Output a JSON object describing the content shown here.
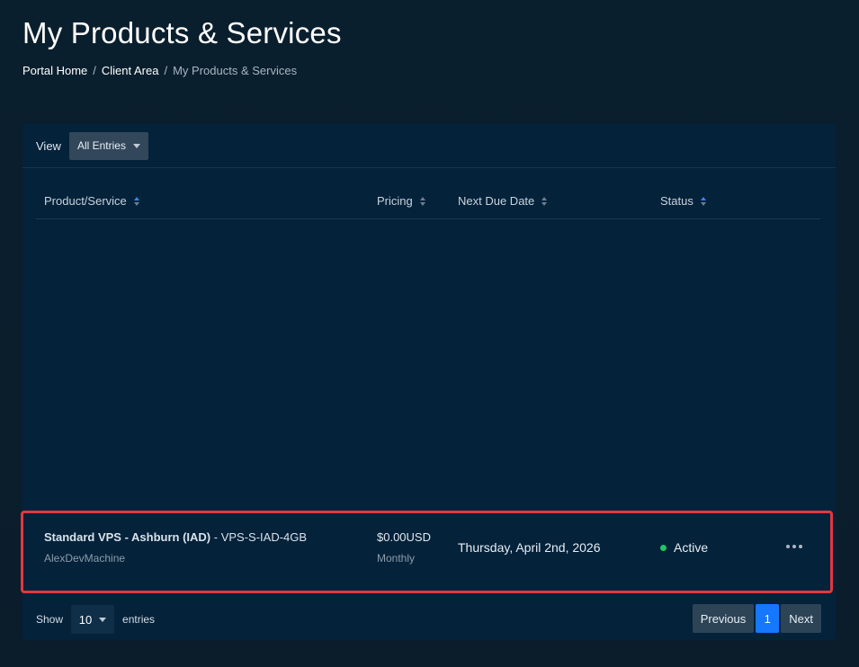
{
  "page": {
    "title": "My Products & Services"
  },
  "breadcrumb": {
    "items": [
      "Portal Home",
      "Client Area"
    ],
    "current": "My Products & Services",
    "separator": "/"
  },
  "toolbar": {
    "view_label": "View",
    "view_value": "All Entries"
  },
  "table": {
    "columns": [
      "Product/Service",
      "Pricing",
      "Next Due Date",
      "Status"
    ],
    "rows": [
      {
        "product_bold": "Standard VPS - Ashburn (IAD)",
        "product_suffix": " - VPS-S-IAD-4GB",
        "domain": "AlexDevMachine",
        "price": "$0.00USD",
        "cycle": "Monthly",
        "next_due": "Thursday, April 2nd, 2026",
        "status": "Active",
        "status_color": "#22c55e"
      }
    ]
  },
  "footer": {
    "show_label": "Show",
    "page_length": "10",
    "entries_label": "entries",
    "previous": "Previous",
    "current_page": "1",
    "next": "Next"
  },
  "colors": {
    "background": "#0a1f2e",
    "card": "#04223a",
    "accent": "#1677ff",
    "highlight_border": "#e0393f"
  }
}
